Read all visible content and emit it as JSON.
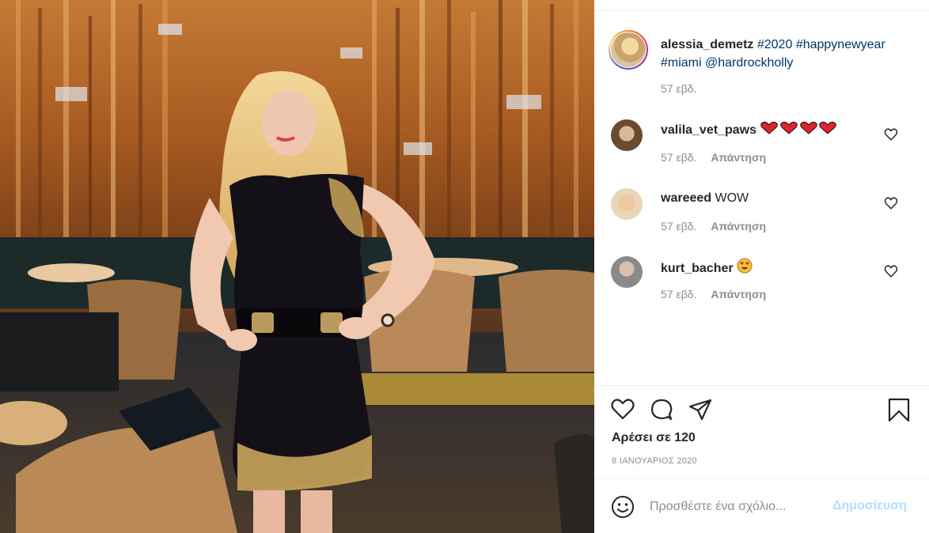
{
  "post": {
    "author": "alessia_demetz",
    "caption_tags": [
      "#2020",
      "#happynewyear",
      "#miami",
      "@hardrockholly"
    ],
    "time": "57 εβδ."
  },
  "comments": [
    {
      "username": "valila_vet_paws",
      "text": "",
      "emoji": "hearts",
      "time": "57 εβδ.",
      "reply_label": "Απάντηση"
    },
    {
      "username": "wareeed",
      "text": "WOW",
      "emoji": "",
      "time": "57 εβδ.",
      "reply_label": "Απάντηση"
    },
    {
      "username": "kurt_bacher",
      "text": "",
      "emoji": "heart-eyes",
      "time": "57 εβδ.",
      "reply_label": "Απάντηση"
    }
  ],
  "actions": {
    "likes": "Αρέσει σε 120",
    "date": "8 ΙΑΝΟΥΑΡΙΟΣ 2020"
  },
  "comment_box": {
    "placeholder": "Προσθέστε ένα σχόλιο...",
    "post_label": "Δημοσίευση"
  },
  "colors": {
    "tag_link": "#00376b",
    "muted": "#8e8e8e",
    "post_disabled": "#b2dffc",
    "heart_red": "#e0242b"
  },
  "icons": [
    "heart-icon",
    "comment-icon",
    "share-icon",
    "bookmark-icon",
    "emoji-icon",
    "like-comment-icon"
  ]
}
